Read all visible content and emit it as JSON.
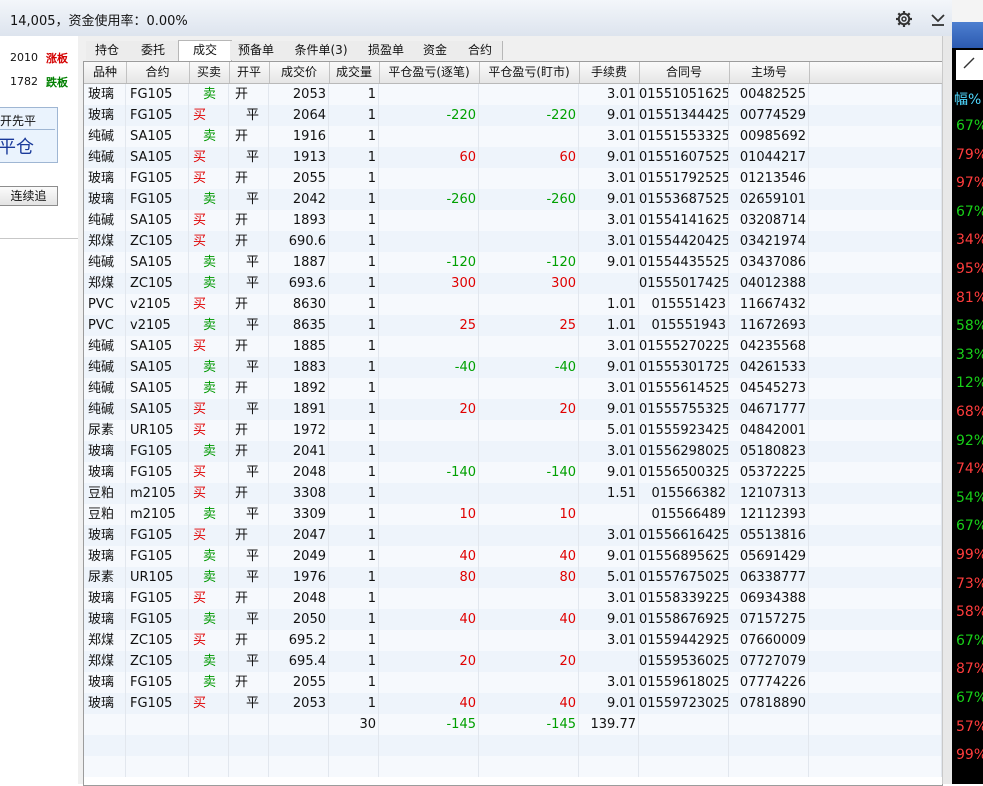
{
  "title": "14,005，资金使用率：0.00%",
  "left": {
    "up_value": "2010",
    "up_label": "涨板",
    "down_value": "1782",
    "down_label": "跌板",
    "box_sub": "开先平",
    "box_main": "平仓",
    "button": "连续追"
  },
  "tabs": [
    "持仓",
    "委托",
    "成交",
    "预备单",
    "条件单(3)",
    "损盈单",
    "资金",
    "合约"
  ],
  "active_tab": "成交",
  "columns": [
    "品种",
    "合约",
    "买卖",
    "开平",
    "成交价",
    "成交量",
    "平仓盈亏(逐笔)",
    "平仓盈亏(盯市)",
    "手续费",
    "合同号",
    "主场号"
  ],
  "trades": [
    [
      "玻璃",
      "FG105",
      "卖",
      "开",
      "2053",
      "1",
      "",
      "",
      "3.01",
      "01551051625",
      "00482525"
    ],
    [
      "玻璃",
      "FG105",
      "买",
      "平",
      "2064",
      "1",
      "-220",
      "-220",
      "9.01",
      "01551344425",
      "00774529"
    ],
    [
      "纯碱",
      "SA105",
      "卖",
      "开",
      "1916",
      "1",
      "",
      "",
      "3.01",
      "01551553325",
      "00985692"
    ],
    [
      "纯碱",
      "SA105",
      "买",
      "平",
      "1913",
      "1",
      "60",
      "60",
      "9.01",
      "01551607525",
      "01044217"
    ],
    [
      "玻璃",
      "FG105",
      "买",
      "开",
      "2055",
      "1",
      "",
      "",
      "3.01",
      "01551792525",
      "01213546"
    ],
    [
      "玻璃",
      "FG105",
      "卖",
      "平",
      "2042",
      "1",
      "-260",
      "-260",
      "9.01",
      "01553687525",
      "02659101"
    ],
    [
      "纯碱",
      "SA105",
      "买",
      "开",
      "1893",
      "1",
      "",
      "",
      "3.01",
      "01554141625",
      "03208714"
    ],
    [
      "郑煤",
      "ZC105",
      "买",
      "开",
      "690.6",
      "1",
      "",
      "",
      "3.01",
      "01554420425",
      "03421974"
    ],
    [
      "纯碱",
      "SA105",
      "卖",
      "平",
      "1887",
      "1",
      "-120",
      "-120",
      "9.01",
      "01554435525",
      "03437086"
    ],
    [
      "郑煤",
      "ZC105",
      "卖",
      "平",
      "693.6",
      "1",
      "300",
      "300",
      "",
      "01555017425",
      "04012388"
    ],
    [
      "PVC",
      "v2105",
      "买",
      "开",
      "8630",
      "1",
      "",
      "",
      "1.01",
      "015551423",
      "11667432"
    ],
    [
      "PVC",
      "v2105",
      "卖",
      "平",
      "8635",
      "1",
      "25",
      "25",
      "1.01",
      "015551943",
      "11672693"
    ],
    [
      "纯碱",
      "SA105",
      "买",
      "开",
      "1885",
      "1",
      "",
      "",
      "3.01",
      "01555270225",
      "04235568"
    ],
    [
      "纯碱",
      "SA105",
      "卖",
      "平",
      "1883",
      "1",
      "-40",
      "-40",
      "9.01",
      "01555301725",
      "04261533"
    ],
    [
      "纯碱",
      "SA105",
      "卖",
      "开",
      "1892",
      "1",
      "",
      "",
      "3.01",
      "01555614525",
      "04545273"
    ],
    [
      "纯碱",
      "SA105",
      "买",
      "平",
      "1891",
      "1",
      "20",
      "20",
      "9.01",
      "01555755325",
      "04671777"
    ],
    [
      "尿素",
      "UR105",
      "买",
      "开",
      "1972",
      "1",
      "",
      "",
      "5.01",
      "01555923425",
      "04842001"
    ],
    [
      "玻璃",
      "FG105",
      "卖",
      "开",
      "2041",
      "1",
      "",
      "",
      "3.01",
      "01556298025",
      "05180823"
    ],
    [
      "玻璃",
      "FG105",
      "买",
      "平",
      "2048",
      "1",
      "-140",
      "-140",
      "9.01",
      "01556500325",
      "05372225"
    ],
    [
      "豆粕",
      "m2105",
      "买",
      "开",
      "3308",
      "1",
      "",
      "",
      "1.51",
      "015566382",
      "12107313"
    ],
    [
      "豆粕",
      "m2105",
      "卖",
      "平",
      "3309",
      "1",
      "10",
      "10",
      "",
      "015566489",
      "12112393"
    ],
    [
      "玻璃",
      "FG105",
      "买",
      "开",
      "2047",
      "1",
      "",
      "",
      "3.01",
      "01556616425",
      "05513816"
    ],
    [
      "玻璃",
      "FG105",
      "卖",
      "平",
      "2049",
      "1",
      "40",
      "40",
      "9.01",
      "01556895625",
      "05691429"
    ],
    [
      "尿素",
      "UR105",
      "卖",
      "平",
      "1976",
      "1",
      "80",
      "80",
      "5.01",
      "01557675025",
      "06338777"
    ],
    [
      "玻璃",
      "FG105",
      "买",
      "开",
      "2048",
      "1",
      "",
      "",
      "3.01",
      "01558339225",
      "06934388"
    ],
    [
      "玻璃",
      "FG105",
      "卖",
      "平",
      "2050",
      "1",
      "40",
      "40",
      "9.01",
      "01558676925",
      "07157275"
    ],
    [
      "郑煤",
      "ZC105",
      "买",
      "开",
      "695.2",
      "1",
      "",
      "",
      "3.01",
      "01559442925",
      "07660009"
    ],
    [
      "郑煤",
      "ZC105",
      "卖",
      "平",
      "695.4",
      "1",
      "20",
      "20",
      "",
      "01559536025",
      "07727079"
    ],
    [
      "玻璃",
      "FG105",
      "卖",
      "开",
      "2055",
      "1",
      "",
      "",
      "3.01",
      "01559618025",
      "07774226"
    ],
    [
      "玻璃",
      "FG105",
      "买",
      "平",
      "2053",
      "1",
      "40",
      "40",
      "9.01",
      "01559723025",
      "07818890"
    ]
  ],
  "totals": {
    "volume": "30",
    "pnl_trade": "-145",
    "pnl_mtm": "-145",
    "fee": "139.77"
  },
  "right_strip": {
    "header": "幅%",
    "values": [
      "67%",
      "79%",
      "97%",
      "67%",
      "34%",
      "95%",
      "81%",
      "58%",
      "33%",
      "12%",
      "68%",
      "92%",
      "74%",
      "54%",
      "67%",
      "99%",
      "73%",
      "58%",
      "67%",
      "87%",
      "67%",
      "57%",
      "99%"
    ]
  },
  "colors": {
    "buy": "#e00000",
    "sell": "#009900",
    "profit": "#e00000",
    "loss": "#00a000"
  },
  "icons": {
    "settings": "gear-icon",
    "collapse": "chevron-down-icon"
  }
}
